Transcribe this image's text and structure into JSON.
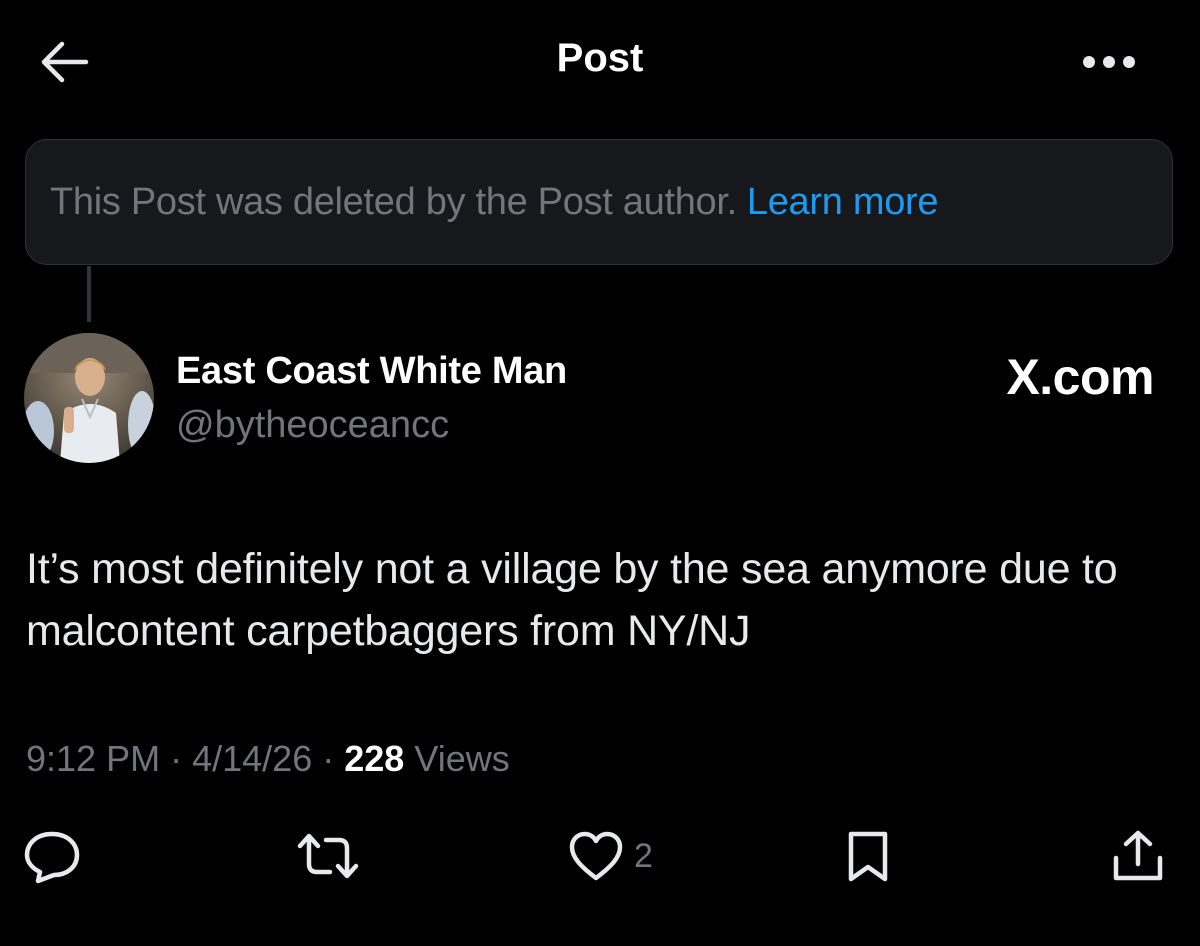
{
  "header": {
    "title": "Post",
    "back_icon": "arrow-left-icon",
    "more_icon": "more-horizontal-icon"
  },
  "deleted_notice": {
    "text": "This Post was deleted by the Post author.",
    "link": "Learn more"
  },
  "author": {
    "display_name": "East Coast White Man",
    "handle": "@bytheoceancc"
  },
  "watermark": "X.com",
  "post": {
    "text": "It’s most definitely not a village by the sea anymore due to malcontent carpetbaggers from NY/NJ",
    "time": "9:12 PM",
    "date": "4/14/26",
    "separator": "·",
    "views_count": "228",
    "views_label": "Views"
  },
  "actions": {
    "reply_icon": "reply-icon",
    "repost_icon": "repost-icon",
    "like_icon": "heart-icon",
    "like_count": "2",
    "bookmark_icon": "bookmark-icon",
    "share_icon": "share-icon"
  },
  "colors": {
    "background": "#000000",
    "text": "#e7e9ea",
    "secondary": "#71767b",
    "link": "#1d9bf0",
    "notice_bg": "#16181c"
  }
}
